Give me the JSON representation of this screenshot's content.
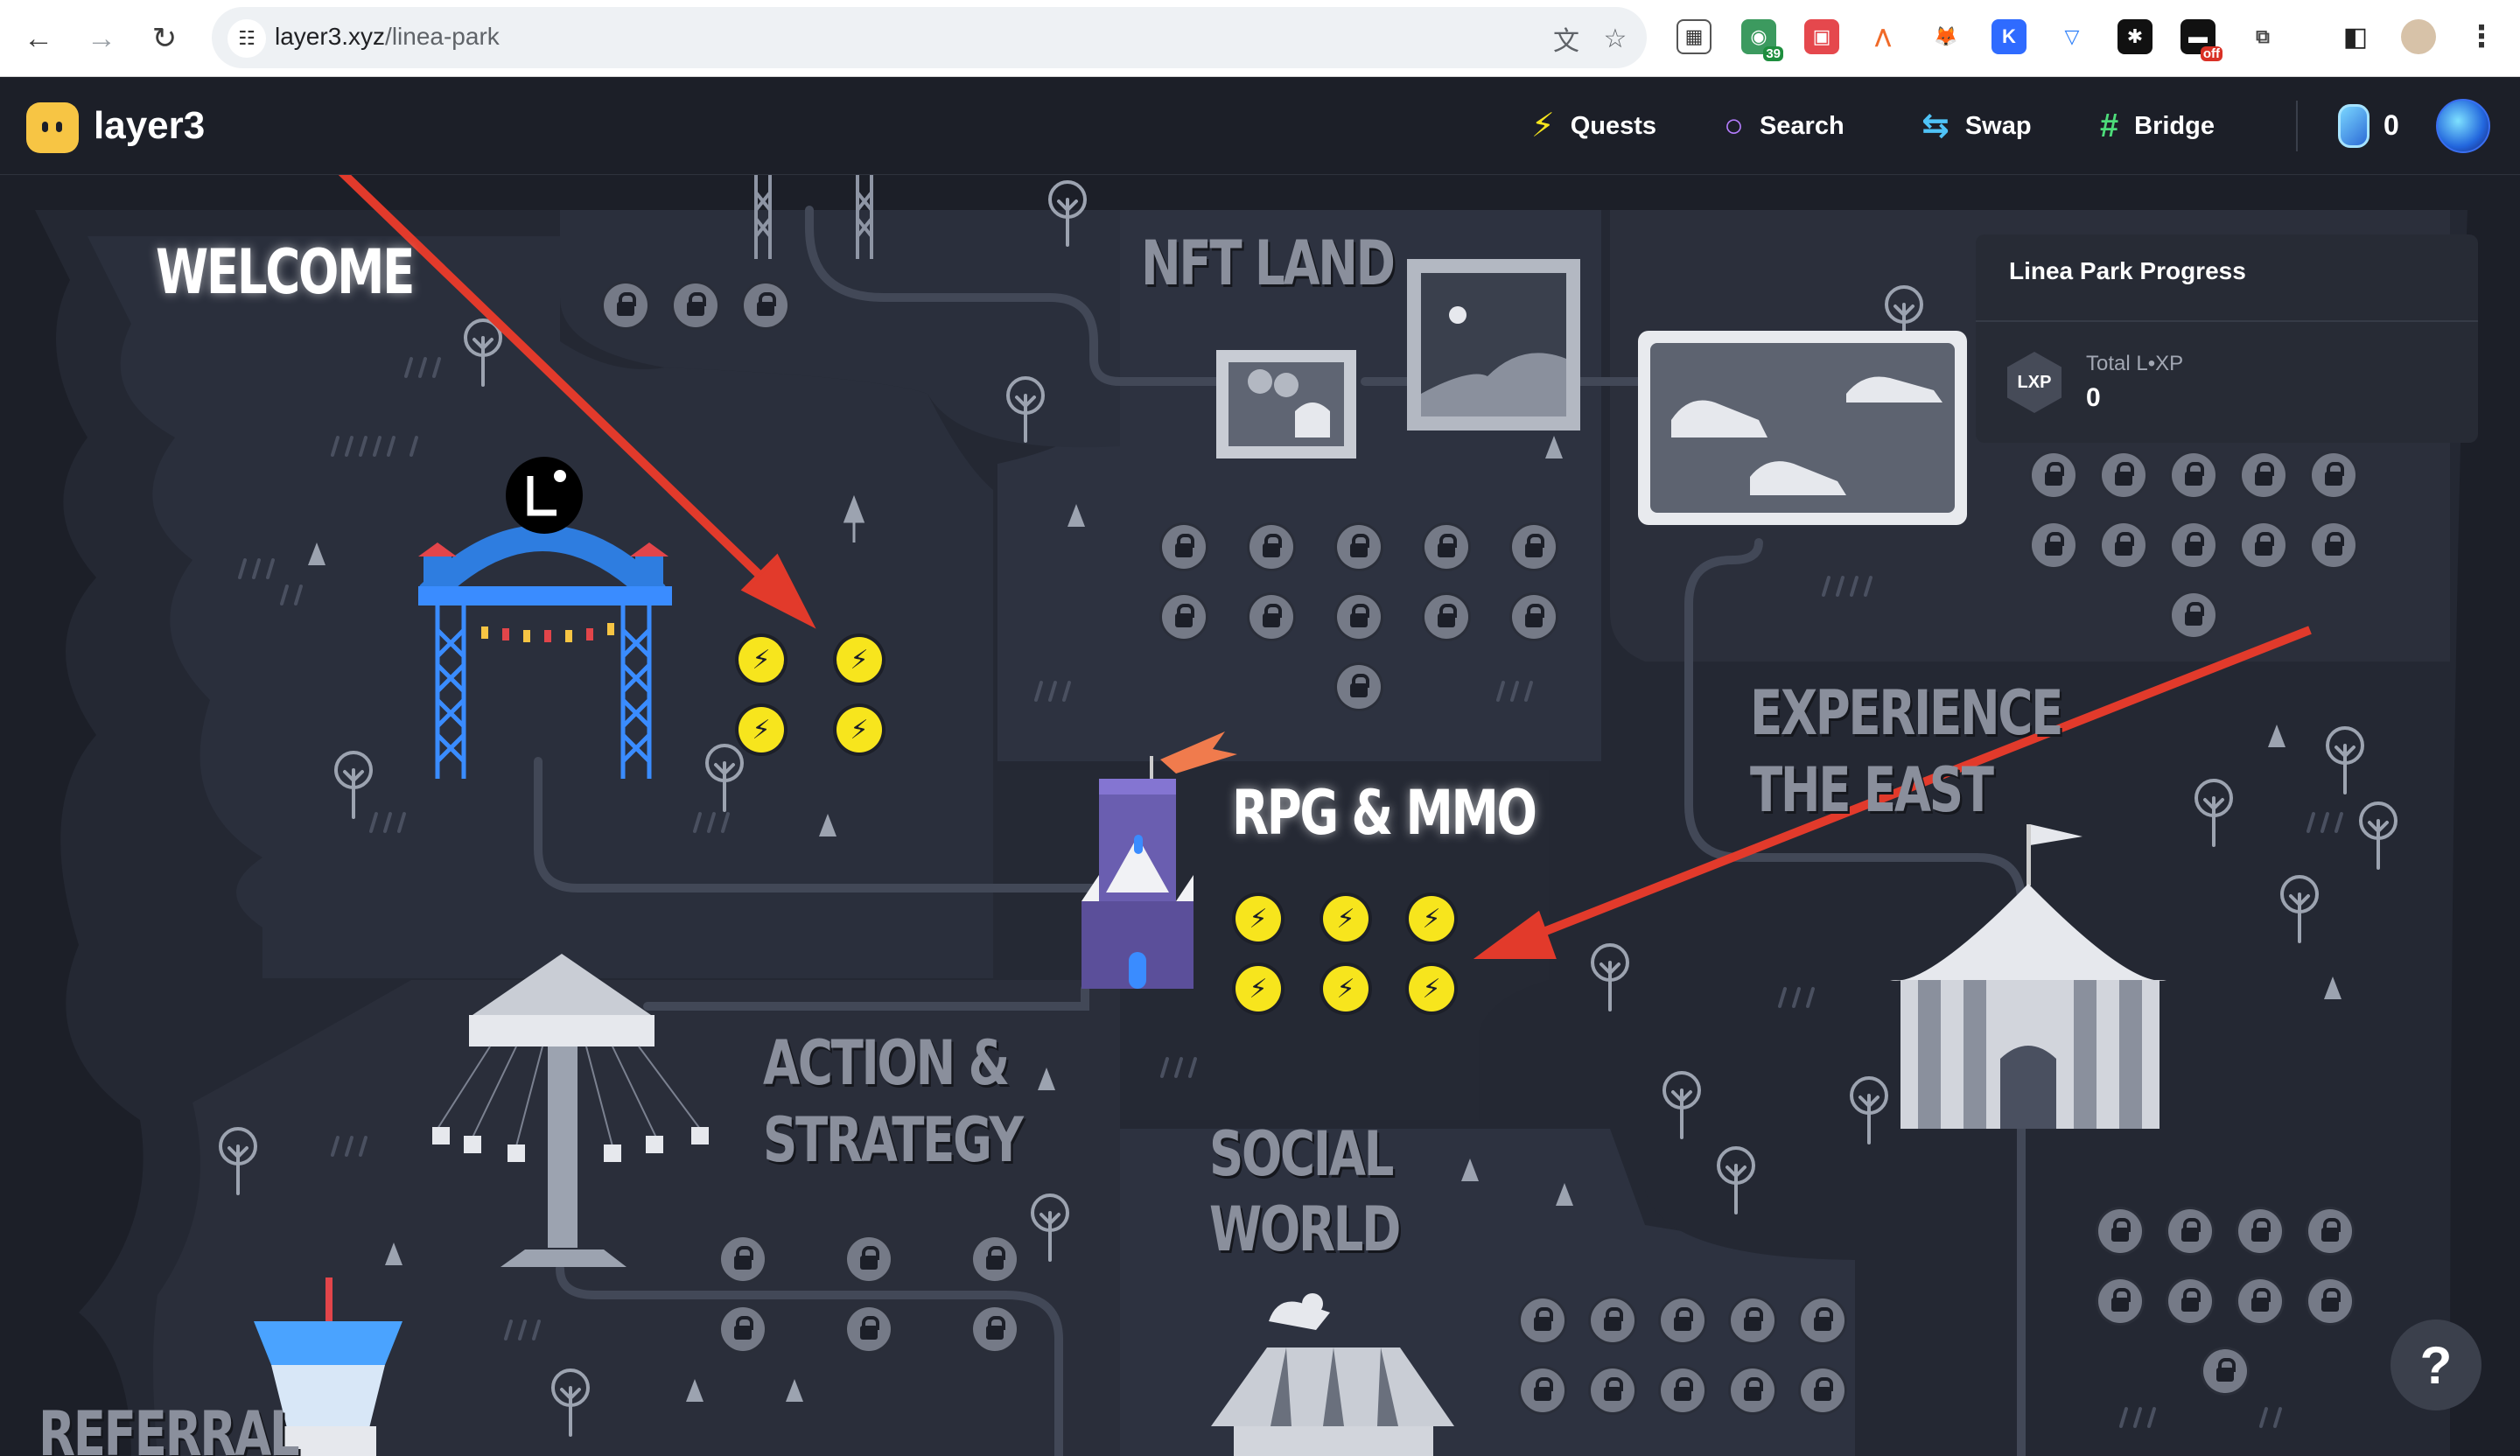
{
  "browser": {
    "url_host": "layer3.xyz",
    "url_path": "/linea-park",
    "extensions": [
      {
        "name": "qr-extension",
        "badge": ""
      },
      {
        "name": "green-extension",
        "badge": "39"
      },
      {
        "name": "red-extension",
        "badge": ""
      },
      {
        "name": "orange-extension",
        "badge": ""
      },
      {
        "name": "metamask-extension",
        "badge": ""
      },
      {
        "name": "k-extension",
        "badge": ""
      },
      {
        "name": "shield-extension",
        "badge": ""
      },
      {
        "name": "dark-extension",
        "badge": ""
      },
      {
        "name": "off-extension",
        "badge": "off"
      },
      {
        "name": "puzzle-extension",
        "badge": ""
      }
    ]
  },
  "app": {
    "logo_text": "layer3",
    "nav": [
      {
        "label": "Quests",
        "icon": "lightning-icon",
        "color": "#f7e51d"
      },
      {
        "label": "Search",
        "icon": "search-icon",
        "color": "#b57dff"
      },
      {
        "label": "Swap",
        "icon": "swap-icon",
        "color": "#4fc3f7"
      },
      {
        "label": "Bridge",
        "icon": "bridge-icon",
        "color": "#4ddc7a"
      }
    ],
    "lxp_balance": "0"
  },
  "map": {
    "zones": {
      "welcome": "WELCOME",
      "nft_land": "NFT LAND",
      "rpg_mmo": "RPG & MMO",
      "experience_line1": "EXPERIENCE",
      "experience_line2": "THE EAST",
      "action_line1": "ACTION &",
      "action_line2": "STRATEGY",
      "social_line1": "SOCIAL",
      "social_line2": "WORLD",
      "referral": "REFERRAL"
    },
    "quest_marker_color": "#f7e51d",
    "lock_color": "#757a87"
  },
  "progress": {
    "title": "Linea Park Progress",
    "badge": "LXP",
    "label": "Total L•XP",
    "value": "0"
  },
  "help_label": "?"
}
